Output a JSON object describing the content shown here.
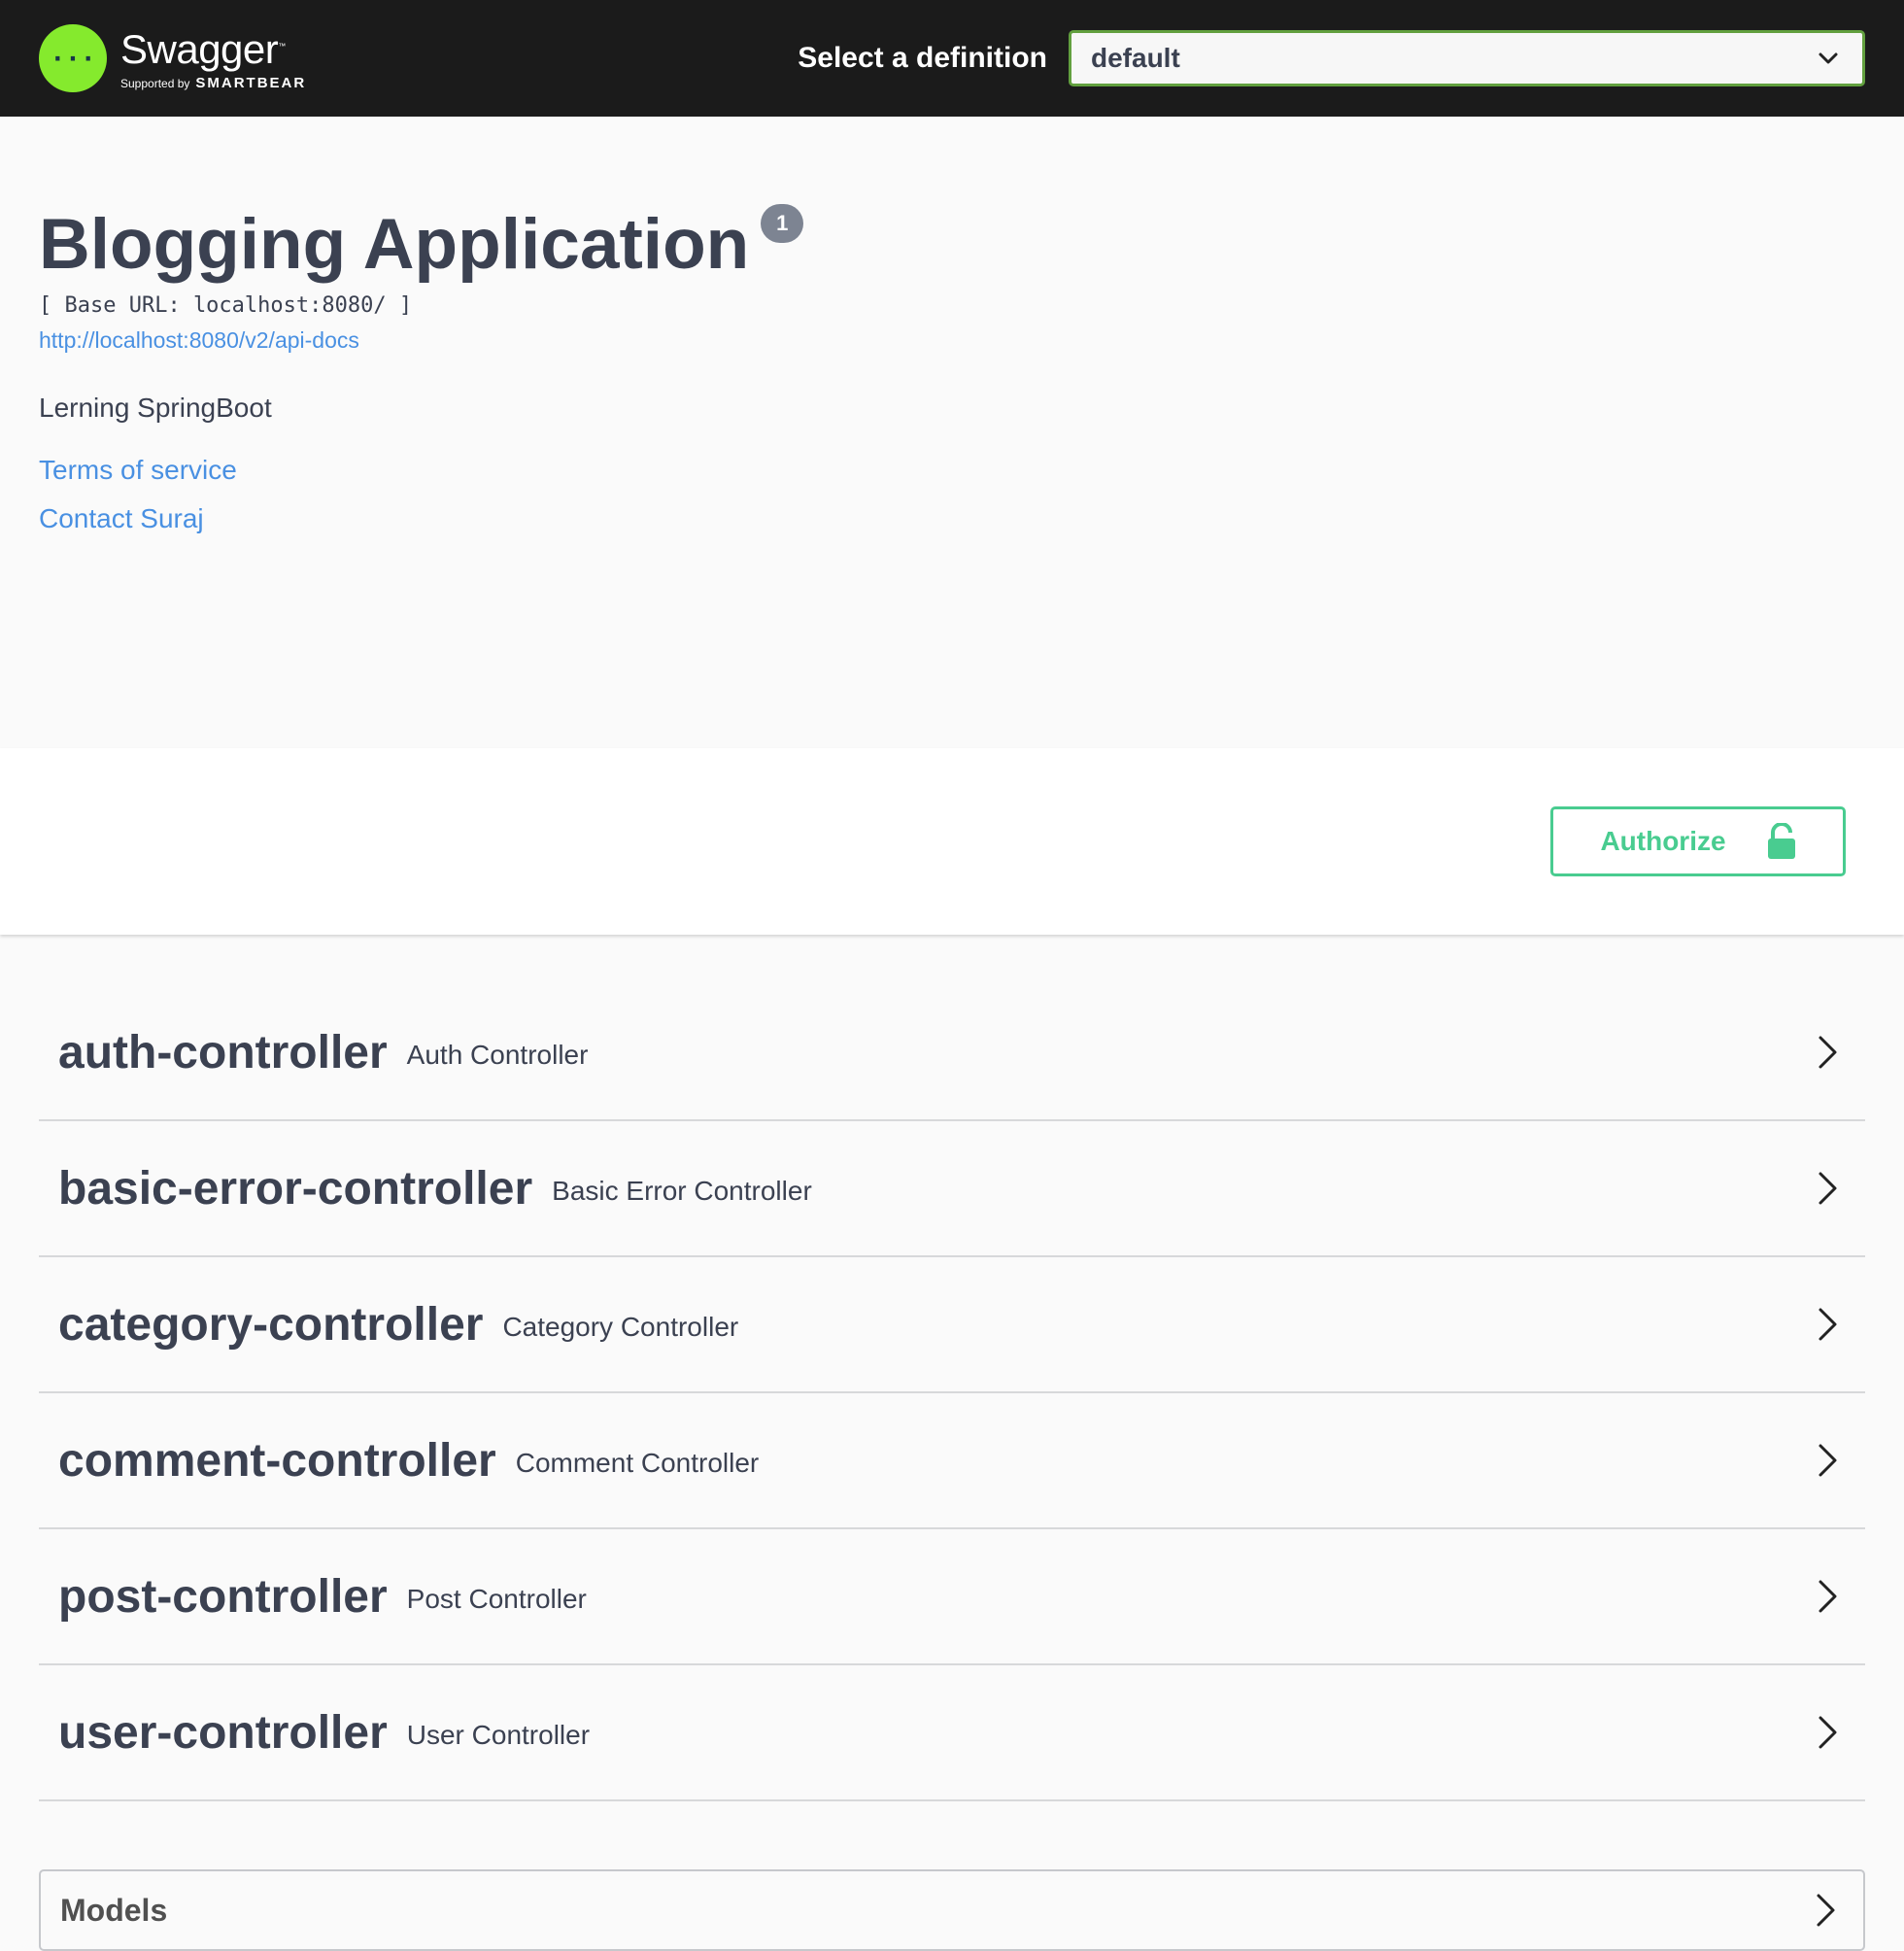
{
  "topbar": {
    "logo_name": "Swagger",
    "logo_tm": "™",
    "logo_supported": "Supported by",
    "logo_brand": "SMARTBEAR",
    "definition_label": "Select a definition",
    "definition_value": "default"
  },
  "info": {
    "title": "Blogging Application",
    "version": "1",
    "base_url": "[ Base URL: localhost:8080/ ]",
    "docs_url": "http://localhost:8080/v2/api-docs",
    "description": "Lerning SpringBoot",
    "terms": "Terms of service",
    "contact": "Contact Suraj"
  },
  "auth": {
    "authorize_label": "Authorize"
  },
  "tags": [
    {
      "name": "auth-controller",
      "description": "Auth Controller"
    },
    {
      "name": "basic-error-controller",
      "description": "Basic Error Controller"
    },
    {
      "name": "category-controller",
      "description": "Category Controller"
    },
    {
      "name": "comment-controller",
      "description": "Comment Controller"
    },
    {
      "name": "post-controller",
      "description": "Post Controller"
    },
    {
      "name": "user-controller",
      "description": "User Controller"
    }
  ],
  "models": {
    "title": "Models"
  },
  "icons": {
    "logo": "swagger-logo-icon",
    "select": "chevron-down-icon",
    "lock": "unlock-icon",
    "expand": "chevron-right-icon"
  },
  "colors": {
    "topbar_bg": "#1b1b1b",
    "logo_green": "#85ea2d",
    "select_border": "#62a03f",
    "authorize_green": "#49cc90",
    "link_blue": "#4990e2",
    "text": "#3b4151"
  }
}
